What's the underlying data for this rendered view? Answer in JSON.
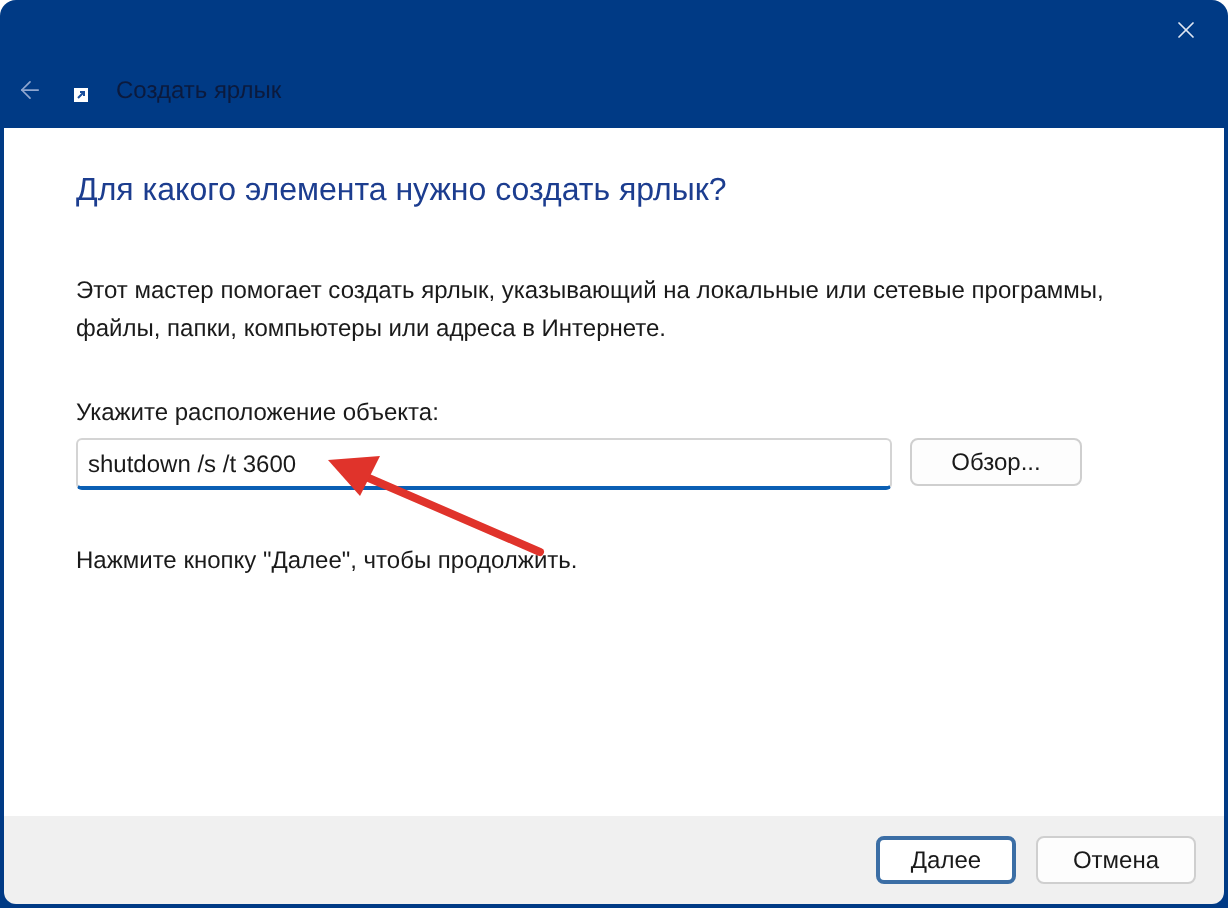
{
  "window": {
    "title": "Создать ярлык"
  },
  "heading": "Для какого элемента нужно создать ярлык?",
  "description": "Этот мастер помогает создать ярлык, указывающий на локальные или сетевые программы, файлы, папки, компьютеры или адреса в Интернете.",
  "location": {
    "label": "Укажите расположение объекта:",
    "value": "shutdown /s /t 3600",
    "browse_button": "Обзор..."
  },
  "hint": "Нажмите кнопку \"Далее\", чтобы продолжить.",
  "buttons": [
    {
      "label": "Далее",
      "default": true
    },
    {
      "label": "Отмена",
      "default": false
    }
  ]
}
